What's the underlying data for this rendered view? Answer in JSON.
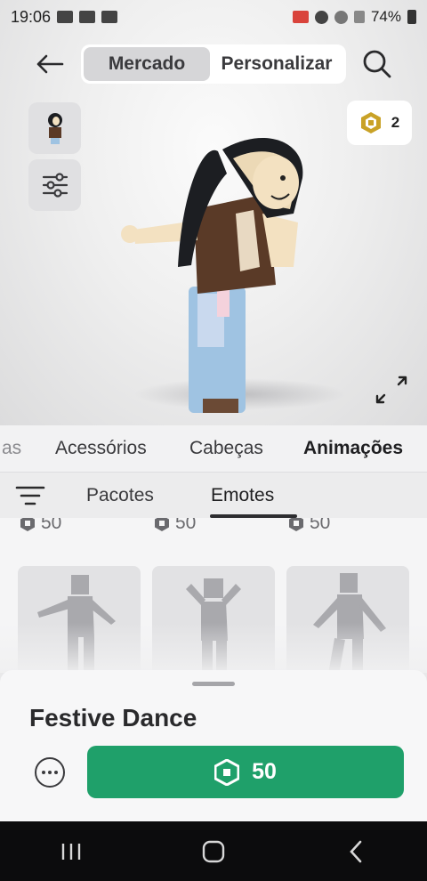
{
  "status_bar": {
    "time": "19:06",
    "battery": "74%"
  },
  "header": {
    "segments": [
      {
        "label": "Mercado",
        "active": true
      },
      {
        "label": "Personalizar",
        "active": false
      }
    ],
    "robux_count": "2"
  },
  "categories": [
    {
      "label": "as",
      "active": false
    },
    {
      "label": "Acessórios",
      "active": false
    },
    {
      "label": "Cabeças",
      "active": false
    },
    {
      "label": "Animações",
      "active": true
    }
  ],
  "subcategories": [
    {
      "label": "Pacotes",
      "active": false
    },
    {
      "label": "Emotes",
      "active": true
    }
  ],
  "grid": {
    "prices": [
      "50",
      "50",
      "50"
    ]
  },
  "item": {
    "name": "Festive Dance",
    "price": "50"
  },
  "colors": {
    "buy_green": "#1fa06a",
    "robux_gold": "#c9a227"
  },
  "icons": {
    "back": "arrow-left-icon",
    "search": "search-icon",
    "robux": "robux-icon",
    "filter": "filter-icon",
    "sliders": "sliders-icon",
    "expand": "expand-icon",
    "more": "more-icon"
  }
}
